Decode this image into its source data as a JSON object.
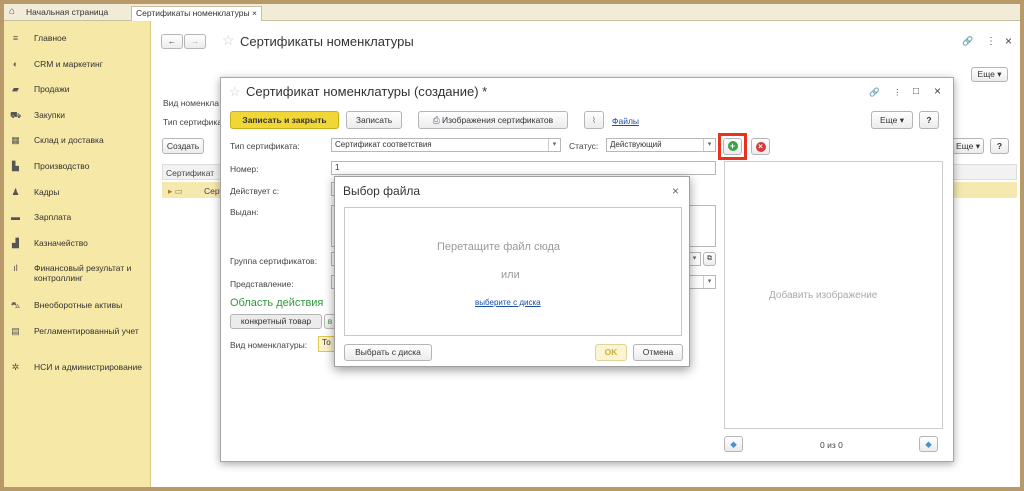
{
  "tabs": {
    "home": "Начальная страница",
    "certs": "Сертификаты номенклатуры",
    "close": "×"
  },
  "sidebar": [
    {
      "icon": "≡",
      "name": "Главное"
    },
    {
      "icon": "◐",
      "name": "CRM и маркетинг"
    },
    {
      "icon": "▰",
      "name": "Продажи"
    },
    {
      "icon": "⛟",
      "name": "Закупки"
    },
    {
      "icon": "▦",
      "name": "Склад и доставка"
    },
    {
      "icon": "▙",
      "name": "Производство"
    },
    {
      "icon": "♟",
      "name": "Кадры"
    },
    {
      "icon": "▬",
      "name": "Зарплата"
    },
    {
      "icon": "▟",
      "name": "Казначейство"
    },
    {
      "icon": "ıl",
      "name": "Финансовый результат и контроллинг"
    },
    {
      "icon": "⛍",
      "name": "Внеоборотные активы"
    },
    {
      "icon": "▤",
      "name": "Регламентированный учет"
    },
    {
      "icon": "✲",
      "name": "НСИ и администрирование"
    }
  ],
  "bg": {
    "back": "←",
    "fwd": "→",
    "star": "☆",
    "title": "Сертификаты номенклатуры",
    "link": "🔗",
    "more": "⋮",
    "close": "×",
    "esche": "Еще ▾",
    "esche2": "Еще ▾",
    "help": "?",
    "vid_label": "Вид номенкла",
    "tip_label": "Тип сертифика",
    "create": "Создать",
    "col": "Сертификат",
    "row": "Серт"
  },
  "dlg": {
    "star": "☆",
    "title": "Сертификат номенклатуры (создание) *",
    "link": "🔗",
    "more": "⋮",
    "max": "□",
    "close": "×",
    "save_close": "Записать и закрыть",
    "save": "Записать",
    "images": "Изображения сертификатов",
    "files": "Файлы",
    "esche": "Еще ▾",
    "help": "?",
    "type_label": "Тип сертификата:",
    "type_value": "Сертификат соответствия",
    "status_label": "Статус:",
    "status_value": "Действующий",
    "number_label": "Номер:",
    "number_value": "1",
    "valid_label": "Действует с:",
    "issued_label": "Выдан:",
    "group_label": "Группа сертификатов:",
    "repr_label": "Представление:",
    "scope": "Область действия",
    "specific": "конкретный товар",
    "specific2": "в",
    "nomen_label": "Вид номенклатуры:",
    "nomen_value": "То",
    "add_image": "Добавить изображение",
    "counter": "0 из 0"
  },
  "filedlg": {
    "title": "Выбор файла",
    "close": "×",
    "drop": "Перетащите файл сюда",
    "or": "или",
    "pick_link": "выберите с диска",
    "pick_btn": "Выбрать с диска",
    "ok": "OK",
    "cancel": "Отмена"
  },
  "colors": {
    "accent": "#f1d735",
    "highlight": "#e8321e",
    "add": "#3aa24a",
    "remove": "#d63b3b",
    "nav": "#4a8fd0"
  }
}
